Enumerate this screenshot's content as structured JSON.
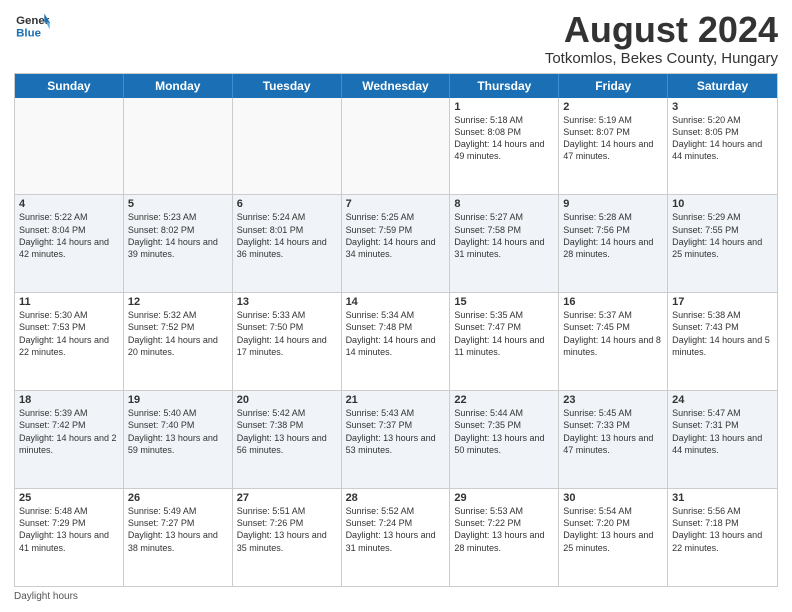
{
  "header": {
    "logo_line1": "General",
    "logo_line2": "Blue",
    "main_title": "August 2024",
    "subtitle": "Totkomlos, Bekes County, Hungary"
  },
  "days_of_week": [
    "Sunday",
    "Monday",
    "Tuesday",
    "Wednesday",
    "Thursday",
    "Friday",
    "Saturday"
  ],
  "rows": [
    {
      "cells": [
        {
          "day": "",
          "text": "",
          "empty": true
        },
        {
          "day": "",
          "text": "",
          "empty": true
        },
        {
          "day": "",
          "text": "",
          "empty": true
        },
        {
          "day": "",
          "text": "",
          "empty": true
        },
        {
          "day": "1",
          "text": "Sunrise: 5:18 AM\nSunset: 8:08 PM\nDaylight: 14 hours and 49 minutes."
        },
        {
          "day": "2",
          "text": "Sunrise: 5:19 AM\nSunset: 8:07 PM\nDaylight: 14 hours and 47 minutes."
        },
        {
          "day": "3",
          "text": "Sunrise: 5:20 AM\nSunset: 8:05 PM\nDaylight: 14 hours and 44 minutes."
        }
      ]
    },
    {
      "alt": true,
      "cells": [
        {
          "day": "4",
          "text": "Sunrise: 5:22 AM\nSunset: 8:04 PM\nDaylight: 14 hours and 42 minutes."
        },
        {
          "day": "5",
          "text": "Sunrise: 5:23 AM\nSunset: 8:02 PM\nDaylight: 14 hours and 39 minutes."
        },
        {
          "day": "6",
          "text": "Sunrise: 5:24 AM\nSunset: 8:01 PM\nDaylight: 14 hours and 36 minutes."
        },
        {
          "day": "7",
          "text": "Sunrise: 5:25 AM\nSunset: 7:59 PM\nDaylight: 14 hours and 34 minutes."
        },
        {
          "day": "8",
          "text": "Sunrise: 5:27 AM\nSunset: 7:58 PM\nDaylight: 14 hours and 31 minutes."
        },
        {
          "day": "9",
          "text": "Sunrise: 5:28 AM\nSunset: 7:56 PM\nDaylight: 14 hours and 28 minutes."
        },
        {
          "day": "10",
          "text": "Sunrise: 5:29 AM\nSunset: 7:55 PM\nDaylight: 14 hours and 25 minutes."
        }
      ]
    },
    {
      "cells": [
        {
          "day": "11",
          "text": "Sunrise: 5:30 AM\nSunset: 7:53 PM\nDaylight: 14 hours and 22 minutes."
        },
        {
          "day": "12",
          "text": "Sunrise: 5:32 AM\nSunset: 7:52 PM\nDaylight: 14 hours and 20 minutes."
        },
        {
          "day": "13",
          "text": "Sunrise: 5:33 AM\nSunset: 7:50 PM\nDaylight: 14 hours and 17 minutes."
        },
        {
          "day": "14",
          "text": "Sunrise: 5:34 AM\nSunset: 7:48 PM\nDaylight: 14 hours and 14 minutes."
        },
        {
          "day": "15",
          "text": "Sunrise: 5:35 AM\nSunset: 7:47 PM\nDaylight: 14 hours and 11 minutes."
        },
        {
          "day": "16",
          "text": "Sunrise: 5:37 AM\nSunset: 7:45 PM\nDaylight: 14 hours and 8 minutes."
        },
        {
          "day": "17",
          "text": "Sunrise: 5:38 AM\nSunset: 7:43 PM\nDaylight: 14 hours and 5 minutes."
        }
      ]
    },
    {
      "alt": true,
      "cells": [
        {
          "day": "18",
          "text": "Sunrise: 5:39 AM\nSunset: 7:42 PM\nDaylight: 14 hours and 2 minutes."
        },
        {
          "day": "19",
          "text": "Sunrise: 5:40 AM\nSunset: 7:40 PM\nDaylight: 13 hours and 59 minutes."
        },
        {
          "day": "20",
          "text": "Sunrise: 5:42 AM\nSunset: 7:38 PM\nDaylight: 13 hours and 56 minutes."
        },
        {
          "day": "21",
          "text": "Sunrise: 5:43 AM\nSunset: 7:37 PM\nDaylight: 13 hours and 53 minutes."
        },
        {
          "day": "22",
          "text": "Sunrise: 5:44 AM\nSunset: 7:35 PM\nDaylight: 13 hours and 50 minutes."
        },
        {
          "day": "23",
          "text": "Sunrise: 5:45 AM\nSunset: 7:33 PM\nDaylight: 13 hours and 47 minutes."
        },
        {
          "day": "24",
          "text": "Sunrise: 5:47 AM\nSunset: 7:31 PM\nDaylight: 13 hours and 44 minutes."
        }
      ]
    },
    {
      "cells": [
        {
          "day": "25",
          "text": "Sunrise: 5:48 AM\nSunset: 7:29 PM\nDaylight: 13 hours and 41 minutes."
        },
        {
          "day": "26",
          "text": "Sunrise: 5:49 AM\nSunset: 7:27 PM\nDaylight: 13 hours and 38 minutes."
        },
        {
          "day": "27",
          "text": "Sunrise: 5:51 AM\nSunset: 7:26 PM\nDaylight: 13 hours and 35 minutes."
        },
        {
          "day": "28",
          "text": "Sunrise: 5:52 AM\nSunset: 7:24 PM\nDaylight: 13 hours and 31 minutes."
        },
        {
          "day": "29",
          "text": "Sunrise: 5:53 AM\nSunset: 7:22 PM\nDaylight: 13 hours and 28 minutes."
        },
        {
          "day": "30",
          "text": "Sunrise: 5:54 AM\nSunset: 7:20 PM\nDaylight: 13 hours and 25 minutes."
        },
        {
          "day": "31",
          "text": "Sunrise: 5:56 AM\nSunset: 7:18 PM\nDaylight: 13 hours and 22 minutes."
        }
      ]
    }
  ],
  "footer": {
    "note": "Daylight hours"
  }
}
